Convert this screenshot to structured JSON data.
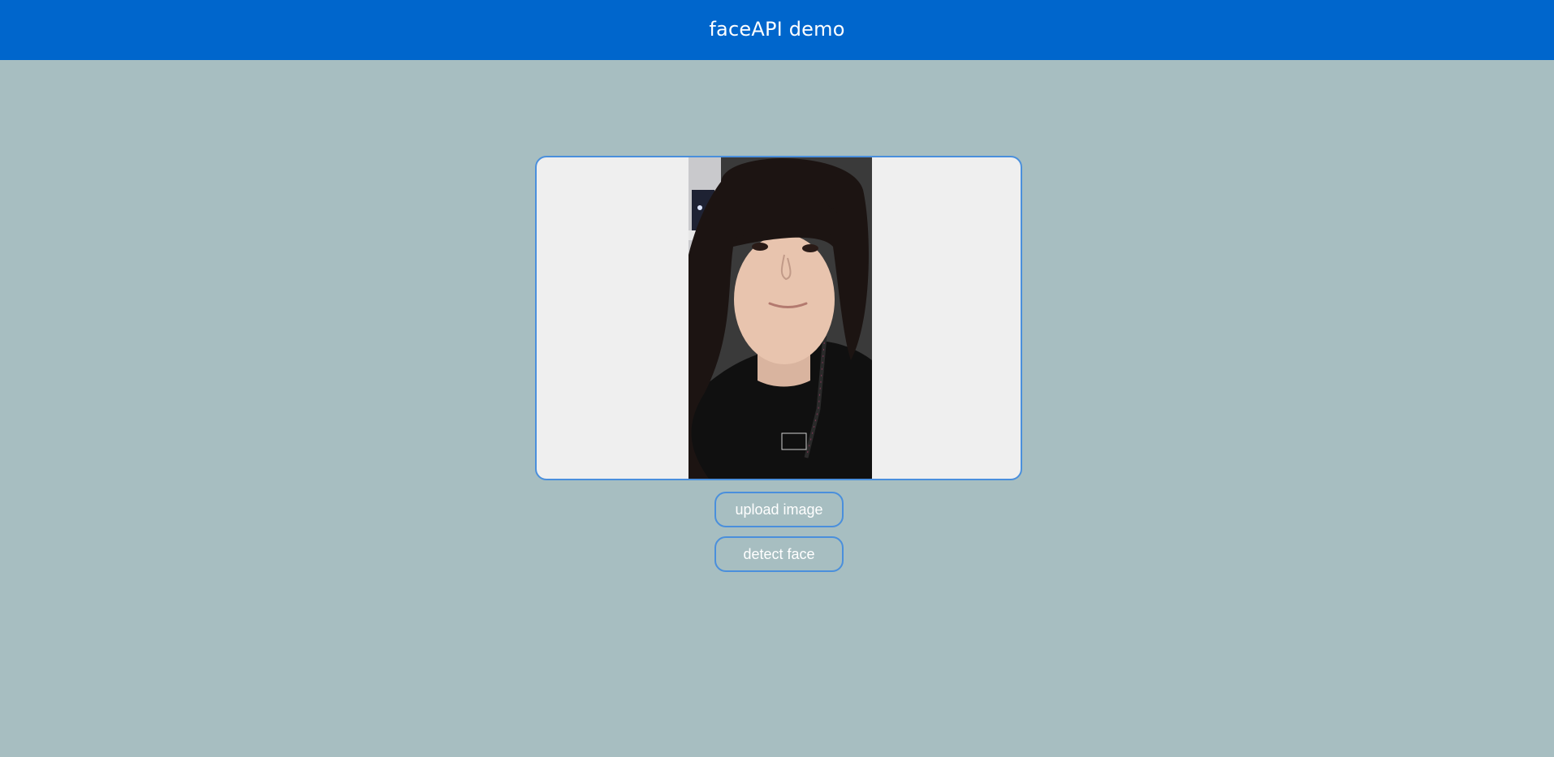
{
  "header": {
    "title": "faceAPI demo",
    "background_color": "#0066cc",
    "text_color": "#ffffff"
  },
  "page": {
    "background_color": "#a7bec1"
  },
  "image_preview": {
    "frame_background": "#efefef",
    "border_color": "#4a8fdc",
    "content": "photo"
  },
  "buttons": {
    "upload_label": "upload image",
    "detect_label": "detect face"
  }
}
